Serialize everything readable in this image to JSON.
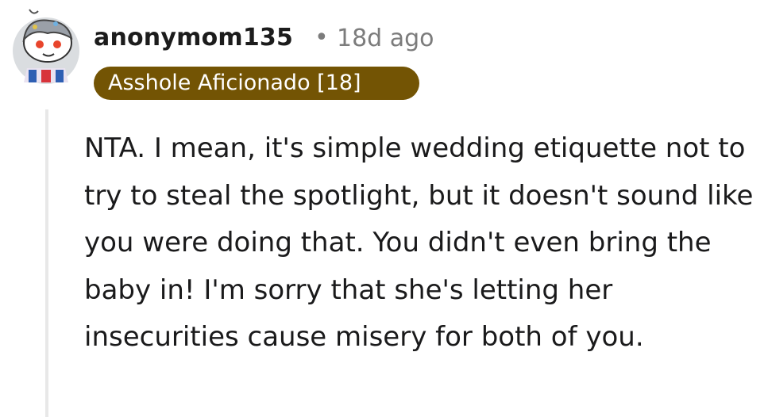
{
  "comment": {
    "username": "anonymom135",
    "separator": "•",
    "timestamp": "18d ago",
    "flair": "Asshole Aficionado [18]",
    "body": "NTA. I mean, it's simple wedding etiquette not to try to steal the spotlight, but it doesn't sound like you were doing that. You didn't even bring the baby in! I'm sorry that she's letting her insecurities cause misery for both of you.",
    "avatar_icon": "snoo-avatar-icon"
  },
  "colors": {
    "flair_bg": "#735404",
    "flair_text": "#ffffff",
    "meta_text": "#7c7c7c",
    "thread_line": "#e8e8e8",
    "avatar_bg": "#dadde0"
  }
}
